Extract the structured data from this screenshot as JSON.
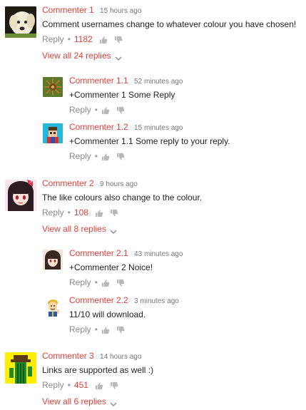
{
  "accent_color": "#e0403a",
  "reply_label": "Reply",
  "separator": "•",
  "comments": [
    {
      "author": "Commenter 1",
      "time": "15 hours ago",
      "text": "Comment usernames change to whatever colour you have chosen!",
      "likes": "1182",
      "view_all": "View all 24 replies",
      "avatar_icon": "dog-avatar-icon",
      "replies": [
        {
          "author": "Commenter 1.1",
          "time": "52 minutes ago",
          "text": "+Commenter 1 Some Reply",
          "avatar_icon": "sun-pattern-avatar-icon"
        },
        {
          "author": "Commenter 1.2",
          "time": "15 minutes ago",
          "text": "+Commenter 1.1 Some reply to your reply.",
          "avatar_icon": "pixel-boy-avatar-icon"
        }
      ]
    },
    {
      "author": "Commenter 2",
      "time": "9 hours ago",
      "text": "The like colours also change to the colour.",
      "likes": "108",
      "view_all": "View all 8 replies",
      "avatar_icon": "anime-girl-avatar-icon",
      "replies": [
        {
          "author": "Commenter 2.1",
          "time": "43 minutes ago",
          "text": "+Commenter 2 Noice!",
          "avatar_icon": "anime-girl-avatar-icon"
        },
        {
          "author": "Commenter 2.2",
          "time": "3 minutes ago",
          "text": "11/10 will download.",
          "avatar_icon": "vault-boy-avatar-icon"
        }
      ]
    },
    {
      "author": "Commenter 3",
      "time": "14 hours ago",
      "text": "Links are supported as well :)",
      "likes": "451",
      "view_all": "View all 6 replies",
      "avatar_icon": "cactus-hat-avatar-icon",
      "replies": []
    }
  ]
}
